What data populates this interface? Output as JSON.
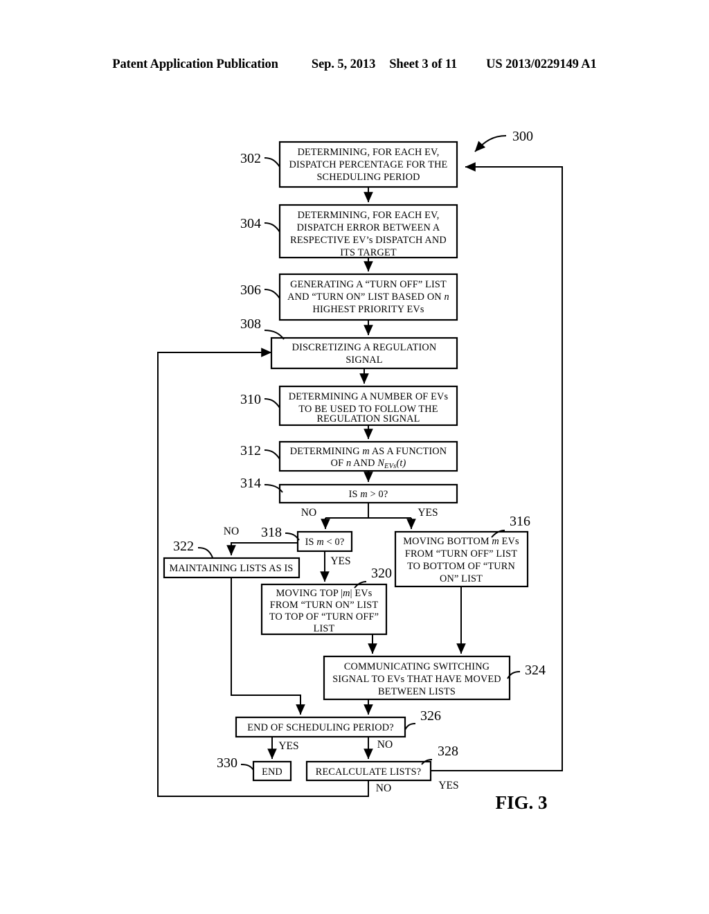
{
  "header": {
    "publication": "Patent Application Publication",
    "date": "Sep. 5, 2013",
    "sheet": "Sheet 3 of 11",
    "docnumber": "US 2013/0229149 A1"
  },
  "figure": {
    "label": "FIG. 3",
    "diagram_ref": "300"
  },
  "nodes": {
    "n302": {
      "ref": "302",
      "lines": [
        "DETERMINING, FOR EACH EV,",
        "DISPATCH PERCENTAGE FOR THE",
        "SCHEDULING PERIOD"
      ]
    },
    "n304": {
      "ref": "304",
      "lines": [
        "DETERMINING, FOR EACH EV,",
        "DISPATCH ERROR BETWEEN A",
        "RESPECTIVE EV’s DISPATCH AND",
        "ITS TARGET"
      ]
    },
    "n306": {
      "ref": "306",
      "lines": [
        "GENERATING A “TURN OFF” LIST",
        "AND “TURN ON” LIST BASED ON  n",
        "HIGHEST PRIORITY EVs"
      ]
    },
    "n308": {
      "ref": "308",
      "lines": [
        "DISCRETIZING A REGULATION",
        "SIGNAL"
      ]
    },
    "n310": {
      "ref": "310",
      "lines": [
        "DETERMINING A NUMBER OF EVs",
        "TO BE USED TO FOLLOW THE",
        "REGULATION SIGNAL"
      ]
    },
    "n312": {
      "ref": "312",
      "lines": [
        "DETERMINING m AS A FUNCTION",
        "OF n AND N_EVs_(t)"
      ]
    },
    "n314": {
      "ref": "314",
      "lines": [
        "IS m > 0?"
      ]
    },
    "n316": {
      "ref": "316",
      "lines": [
        "MOVING BOTTOM m EVs",
        "FROM “TURN OFF” LIST",
        "TO BOTTOM OF “TURN",
        "ON” LIST"
      ]
    },
    "n318": {
      "ref": "318",
      "lines": [
        "IS m < 0?"
      ]
    },
    "n320": {
      "ref": "320",
      "lines": [
        "MOVING TOP |m| EVs",
        "FROM “TURN ON” LIST",
        "TO TOP OF “TURN OFF”",
        "LIST"
      ]
    },
    "n322": {
      "ref": "322",
      "lines": [
        "MAINTAINING LISTS AS IS"
      ]
    },
    "n324": {
      "ref": "324",
      "lines": [
        "COMMUNICATING SWITCHING",
        "SIGNAL TO EVs THAT HAVE MOVED",
        "BETWEEN LISTS"
      ]
    },
    "n326": {
      "ref": "326",
      "lines": [
        "END OF SCHEDULING PERIOD?"
      ]
    },
    "n328": {
      "ref": "328",
      "lines": [
        "RECALCULATE LISTS?"
      ]
    },
    "n330": {
      "ref": "330",
      "lines": [
        "END"
      ]
    }
  },
  "edge_labels": {
    "e314_no": "NO",
    "e314_yes": "YES",
    "e318_no": "NO",
    "e318_yes": "YES",
    "e326_yes": "YES",
    "e326_no": "NO",
    "e328_yes": "YES",
    "e328_no": "NO"
  }
}
